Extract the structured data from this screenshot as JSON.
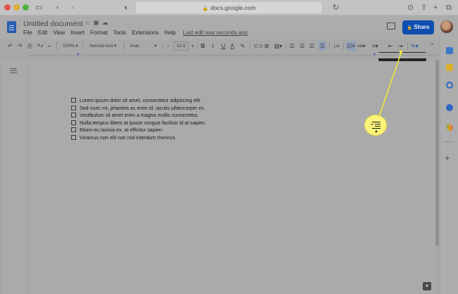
{
  "browser": {
    "url": "docs.google.com"
  },
  "doc": {
    "title": "Untitled document",
    "menu": [
      "File",
      "Edit",
      "View",
      "Insert",
      "Format",
      "Tools",
      "Extensions",
      "Help"
    ],
    "last_edit": "Last edit was seconds ago",
    "share_label": "Share"
  },
  "toolbar": {
    "zoom": "100%",
    "style": "Normal text",
    "font": "Arial",
    "font_size": "10.5",
    "bold": "B",
    "italic": "I",
    "underline": "U",
    "text_color": "A",
    "minus": "−",
    "plus": "+"
  },
  "tooltip": {
    "text": "Increase indent (⌘+])"
  },
  "checklist": {
    "items": [
      "Lorem ipsum dolor sit amet, consectetur adipiscing elit.",
      "Sed nunc mi, pharetra ac enim id, iaculis ullamcorper ex.",
      "Vestibulum sit amet enim a magna mollis consectetur.",
      "Nulla tempus libero at ipsum congue facilisis id at sapien.",
      "Etiam eu lacinia ex, at efficitur sapien.",
      "Vivamus non elit non nisl interdum rhoncus."
    ]
  },
  "colors": {
    "share": "#0f4fb0",
    "callout": "#fbf37a",
    "tooltip_bg": "#242424"
  }
}
